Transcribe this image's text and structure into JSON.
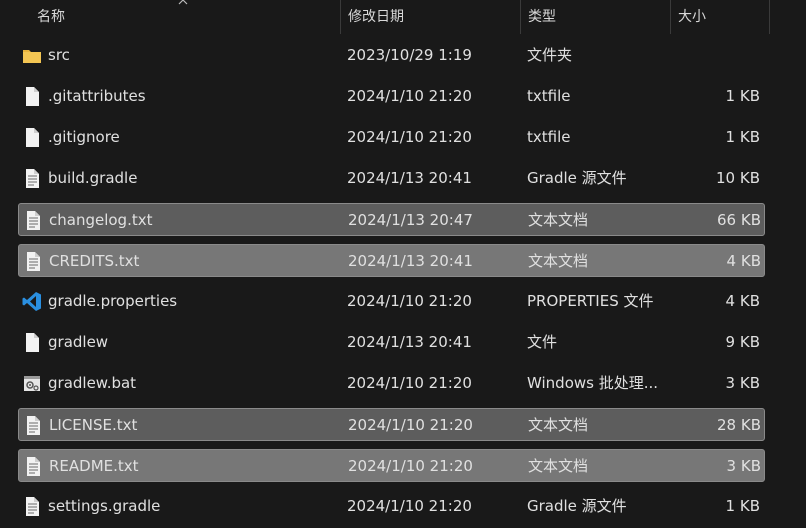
{
  "header": {
    "name": "名称",
    "date": "修改日期",
    "type": "类型",
    "size": "大小"
  },
  "files": [
    {
      "name": "src",
      "date": "2023/10/29 1:19",
      "type": "文件夹",
      "size": "",
      "icon": "folder-icon",
      "selected": false
    },
    {
      "name": ".gitattributes",
      "date": "2024/1/10 21:20",
      "type": "txtfile",
      "size": "1 KB",
      "icon": "blank-file-icon",
      "selected": false
    },
    {
      "name": ".gitignore",
      "date": "2024/1/10 21:20",
      "type": "txtfile",
      "size": "1 KB",
      "icon": "blank-file-icon",
      "selected": false
    },
    {
      "name": "build.gradle",
      "date": "2024/1/13 20:41",
      "type": "Gradle 源文件",
      "size": "10 KB",
      "icon": "text-file-icon",
      "selected": false
    },
    {
      "name": "changelog.txt",
      "date": "2024/1/13 20:47",
      "type": "文本文档",
      "size": "66 KB",
      "icon": "text-file-icon",
      "selected": true
    },
    {
      "name": "CREDITS.txt",
      "date": "2024/1/13 20:41",
      "type": "文本文档",
      "size": "4 KB",
      "icon": "text-file-icon",
      "selected": true
    },
    {
      "name": "gradle.properties",
      "date": "2024/1/10 21:20",
      "type": "PROPERTIES 文件",
      "size": "4 KB",
      "icon": "vscode-icon",
      "selected": false
    },
    {
      "name": "gradlew",
      "date": "2024/1/13 20:41",
      "type": "文件",
      "size": "9 KB",
      "icon": "blank-file-icon",
      "selected": false
    },
    {
      "name": "gradlew.bat",
      "date": "2024/1/10 21:20",
      "type": "Windows 批处理...",
      "size": "3 KB",
      "icon": "batch-file-icon",
      "selected": false
    },
    {
      "name": "LICENSE.txt",
      "date": "2024/1/10 21:20",
      "type": "文本文档",
      "size": "28 KB",
      "icon": "text-file-icon",
      "selected": true
    },
    {
      "name": "README.txt",
      "date": "2024/1/10 21:20",
      "type": "文本文档",
      "size": "3 KB",
      "icon": "text-file-icon",
      "selected": true
    },
    {
      "name": "settings.gradle",
      "date": "2024/1/10 21:20",
      "type": "Gradle 源文件",
      "size": "1 KB",
      "icon": "text-file-icon",
      "selected": false
    }
  ],
  "colors": {
    "background": "#191919",
    "selection": "#5d5d5d",
    "folder": "#f2c14e",
    "vscode": "#2a8fe0"
  }
}
